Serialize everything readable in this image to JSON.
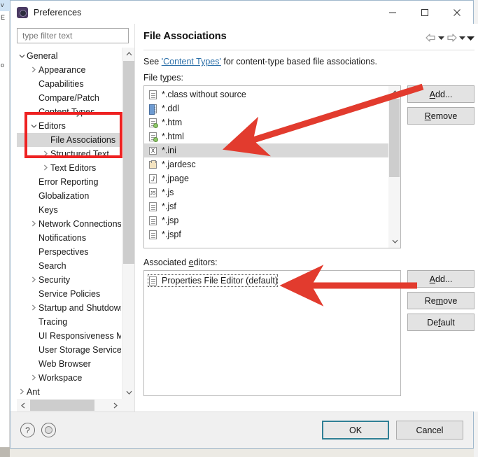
{
  "window": {
    "title": "Preferences",
    "icon": "preferences-icon",
    "minimize_label": "—",
    "maximize_label": "☐",
    "close_label": "✕"
  },
  "sidebar": {
    "filter_placeholder": "type filter text",
    "filter_value": "",
    "items": [
      {
        "label": "General",
        "indent": 0,
        "arrow": "v",
        "selected": false
      },
      {
        "label": "Appearance",
        "indent": 1,
        "arrow": ">",
        "selected": false
      },
      {
        "label": "Capabilities",
        "indent": 1,
        "arrow": "",
        "selected": false
      },
      {
        "label": "Compare/Patch",
        "indent": 1,
        "arrow": "",
        "selected": false
      },
      {
        "label": "Content Types",
        "indent": 1,
        "arrow": "",
        "selected": false
      },
      {
        "label": "Editors",
        "indent": 1,
        "arrow": "v",
        "selected": false
      },
      {
        "label": "File Associations",
        "indent": 2,
        "arrow": "",
        "selected": true
      },
      {
        "label": "Structured Text",
        "indent": 2,
        "arrow": ">",
        "selected": false
      },
      {
        "label": "Text Editors",
        "indent": 2,
        "arrow": ">",
        "selected": false
      },
      {
        "label": "Error Reporting",
        "indent": 1,
        "arrow": "",
        "selected": false
      },
      {
        "label": "Globalization",
        "indent": 1,
        "arrow": "",
        "selected": false
      },
      {
        "label": "Keys",
        "indent": 1,
        "arrow": "",
        "selected": false
      },
      {
        "label": "Network Connections",
        "indent": 1,
        "arrow": ">",
        "selected": false
      },
      {
        "label": "Notifications",
        "indent": 1,
        "arrow": "",
        "selected": false
      },
      {
        "label": "Perspectives",
        "indent": 1,
        "arrow": "",
        "selected": false
      },
      {
        "label": "Search",
        "indent": 1,
        "arrow": "",
        "selected": false
      },
      {
        "label": "Security",
        "indent": 1,
        "arrow": ">",
        "selected": false
      },
      {
        "label": "Service Policies",
        "indent": 1,
        "arrow": "",
        "selected": false
      },
      {
        "label": "Startup and Shutdown",
        "indent": 1,
        "arrow": ">",
        "selected": false
      },
      {
        "label": "Tracing",
        "indent": 1,
        "arrow": "",
        "selected": false
      },
      {
        "label": "UI Responsiveness Monitoring",
        "indent": 1,
        "arrow": "",
        "selected": false
      },
      {
        "label": "User Storage Service",
        "indent": 1,
        "arrow": "",
        "selected": false
      },
      {
        "label": "Web Browser",
        "indent": 1,
        "arrow": "",
        "selected": false
      },
      {
        "label": "Workspace",
        "indent": 1,
        "arrow": ">",
        "selected": false
      },
      {
        "label": "Ant",
        "indent": 0,
        "arrow": ">",
        "selected": false
      }
    ]
  },
  "page": {
    "title": "File Associations",
    "nav": {
      "back_icon": "arrow-left-icon",
      "back_menu_icon": "chevron-down-icon",
      "forward_icon": "arrow-right-icon",
      "forward_menu_icon": "chevron-down-icon",
      "view_menu_icon": "chevron-down-icon"
    },
    "description": {
      "prefix": "See ",
      "link": "'Content Types'",
      "suffix": " for content-type based file associations."
    },
    "file_types_label": "File types:",
    "file_types": [
      {
        "name": "*.class without source",
        "icon": "document-icon",
        "selected": false
      },
      {
        "name": "*.ddl",
        "icon": "ddl-file-icon",
        "selected": false
      },
      {
        "name": "*.htm",
        "icon": "html-file-icon",
        "selected": false
      },
      {
        "name": "*.html",
        "icon": "html-file-icon",
        "selected": false
      },
      {
        "name": "*.ini",
        "icon": "ini-file-icon",
        "selected": true
      },
      {
        "name": "*.jardesc",
        "icon": "jar-file-icon",
        "selected": false
      },
      {
        "name": "*.jpage",
        "icon": "jpage-file-icon",
        "selected": false
      },
      {
        "name": "*.js",
        "icon": "js-file-icon",
        "selected": false
      },
      {
        "name": "*.jsf",
        "icon": "document-icon",
        "selected": false
      },
      {
        "name": "*.jsp",
        "icon": "document-icon",
        "selected": false
      },
      {
        "name": "*.jspf",
        "icon": "document-icon",
        "selected": false
      }
    ],
    "file_type_buttons": [
      {
        "label": "Add...",
        "mnemonic": "A"
      },
      {
        "label": "Remove",
        "mnemonic": "R"
      }
    ],
    "associated_editors_label": "Associated editors:",
    "associated_editors": [
      {
        "name": "Properties File Editor (default)",
        "icon": "document-icon",
        "focused": true
      }
    ],
    "editor_buttons": [
      {
        "label": "Add...",
        "mnemonic": "A"
      },
      {
        "label": "Remove",
        "mnemonic": "m"
      },
      {
        "label": "Default",
        "mnemonic": "f"
      }
    ]
  },
  "footer": {
    "help_icon": "question-mark-icon",
    "apply_icon": "apply-settings-icon",
    "ok_label": "OK",
    "cancel_label": "Cancel"
  },
  "annotations": {
    "box_color": "#ee2222",
    "arrow_color": "#e23b2e",
    "highlight_target_tree": "Editors / File Associations / Structured Text",
    "arrow_1_target": "*.ini",
    "arrow_2_target": "Properties File Editor (default)"
  },
  "colors": {
    "accent": "#2f7f95",
    "link": "#2b6fa8",
    "selection": "#d8d8d8",
    "annotation_red": "#ee2222"
  }
}
